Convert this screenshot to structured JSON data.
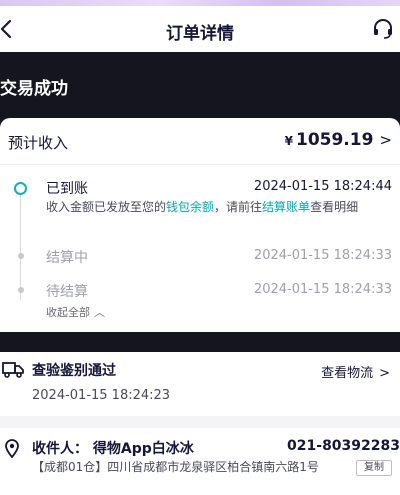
{
  "nav": {
    "title": "订单详情"
  },
  "banner": {
    "status": "交易成功"
  },
  "income": {
    "label": "预计收入",
    "currency": "¥",
    "amount": "1059.19",
    "chevron": ">"
  },
  "timeline": {
    "steps": [
      {
        "label": "已到账",
        "time": "2024-01-15 18:24:44",
        "active": true
      },
      {
        "label": "结算中",
        "time": "2024-01-15 18:24:33",
        "active": false
      },
      {
        "label": "待结算",
        "time": "2024-01-15 18:24:33",
        "active": false
      }
    ],
    "desc_part1": "收入金额已发放至您的",
    "desc_link1": "钱包余额",
    "desc_part2": "，请前往",
    "desc_link2": "结算账单",
    "desc_part3": "查看明细",
    "collapse_label": "收起全部",
    "collapse_icon": "︿",
    "accent_color": "#0bb3b8"
  },
  "inspection": {
    "title": "查验鉴别通过",
    "time": "2024-01-15 18:24:23",
    "logistics_label": "查看物流",
    "chevron": ">"
  },
  "address": {
    "recipient": "收件人：  得物App白冰冰",
    "phone": "021-80392283",
    "detail": "【成都01仓】四川省成都市龙泉驿区柏合镇南六路1号",
    "copy_label": "复制"
  }
}
